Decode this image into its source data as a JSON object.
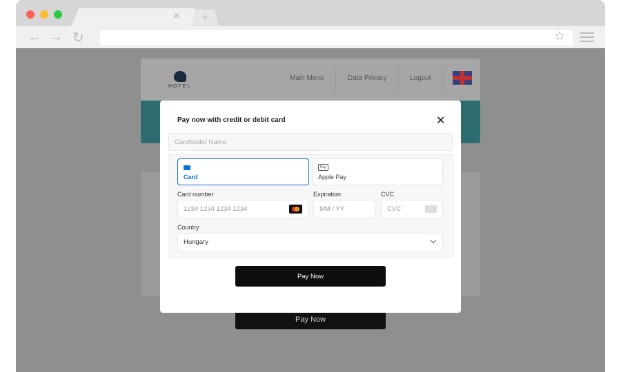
{
  "browser": {
    "new_tab": "+",
    "close_tab": "×",
    "back": "←",
    "forward": "→",
    "reload": "↻",
    "star": "☆"
  },
  "header": {
    "logo": "HOTEL",
    "nav": [
      "Main Menu",
      "Data Privacy",
      "Logout"
    ],
    "language": "English (UK flag)"
  },
  "background_button": "Pay Now",
  "modal": {
    "title": "Pay now with credit or debit card",
    "close": "✕",
    "cardholder_placeholder": "Cardholder Name",
    "methods": [
      {
        "label": "Card",
        "icon": "credit-card-icon",
        "selected": true
      },
      {
        "label": "Apple Pay",
        "icon": "apple-pay-icon",
        "badge": "Pay",
        "selected": false
      }
    ],
    "card_number_label": "Card number",
    "card_number_placeholder": "1234 1234 1234 1234",
    "expiration_label": "Expiration",
    "expiration_placeholder": "MM / YY",
    "cvc_label": "CVC",
    "cvc_placeholder": "CVC",
    "country_label": "Country",
    "country_value": "Hungary",
    "pay_button": "Pay Now"
  },
  "colors": {
    "accent": "#0570de",
    "teal": "#2d6d6f",
    "button": "#0d0d0d"
  }
}
